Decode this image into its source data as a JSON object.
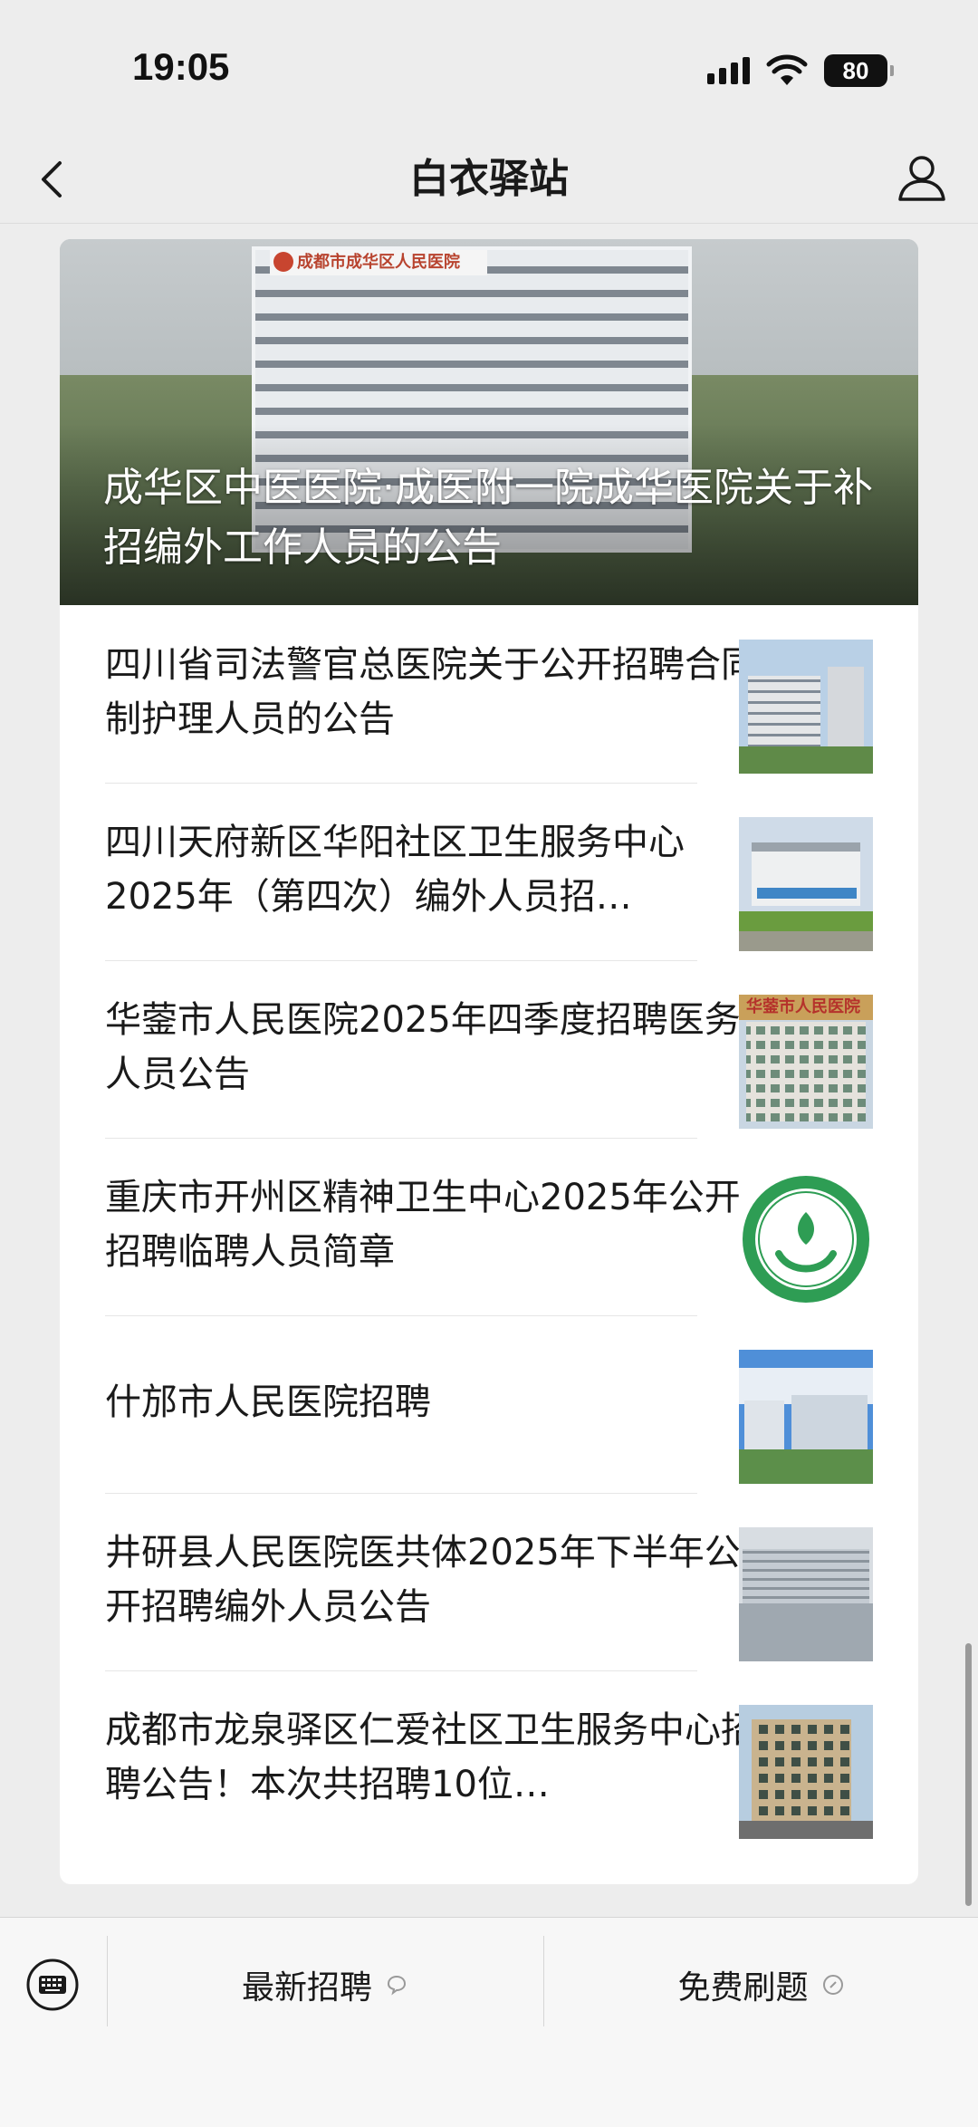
{
  "status_bar": {
    "time": "19:05",
    "battery": "80",
    "icons": [
      "signal-icon",
      "wifi-icon",
      "battery-icon"
    ]
  },
  "nav": {
    "title": "白衣驿站",
    "back_icon": "chevron-left-icon",
    "profile_icon": "user-icon"
  },
  "featured": {
    "title": "成华区中医医院·成医附一院成华医院关于补招编外工作人员的公告",
    "image_sign": "成都市成华区人民医院"
  },
  "articles": [
    {
      "title": "四川省司法警官总医院关于公开招聘合同制护理人员的公告",
      "thumb": "hospital-building-thumb"
    },
    {
      "title": "四川天府新区华阳社区卫生服务中心2025年（第四次）编外人员招…",
      "thumb": "community-health-center-thumb"
    },
    {
      "title": "华蓥市人民医院2025年四季度招聘医务人员公告",
      "thumb": "huaying-hospital-thumb",
      "thumb_sign": "华蓥市人民医院"
    },
    {
      "title": "重庆市开州区精神卫生中心2025年公开招聘临聘人员简章",
      "thumb": "kaizhou-logo-thumb"
    },
    {
      "title": "什邡市人民医院招聘",
      "thumb": "shifang-hospital-thumb"
    },
    {
      "title": "井研县人民医院医共体2025年下半年公开招聘编外人员公告",
      "thumb": "jingyan-hospital-thumb"
    },
    {
      "title": "成都市龙泉驿区仁爱社区卫生服务中心招聘公告！本次共招聘10位…",
      "thumb": "renai-center-thumb"
    }
  ],
  "bottom_menu": {
    "keyboard_icon": "keyboard-icon",
    "items": [
      {
        "label": "最新招聘",
        "icon": "chat-bubble-icon"
      },
      {
        "label": "免费刷题",
        "icon": "link-icon"
      }
    ]
  },
  "colors": {
    "page_bg": "#ededed",
    "card_bg": "#ffffff",
    "logo_green": "#2e9d54"
  }
}
